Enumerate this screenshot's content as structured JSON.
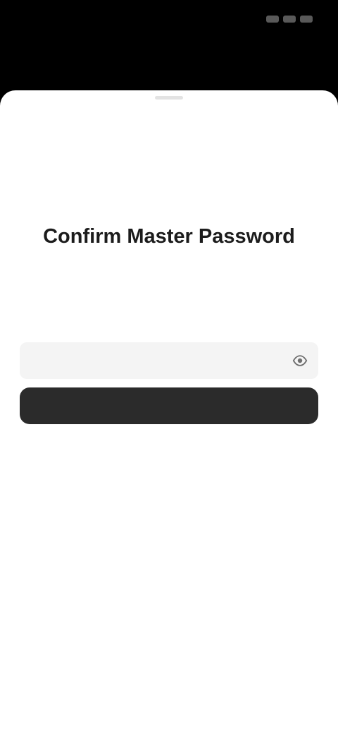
{
  "status_bar": {
    "time": "",
    "icons": [
      "signal-icon",
      "wifi-icon",
      "battery-icon"
    ]
  },
  "screen": {
    "title": "Confirm Master Password",
    "subtitle": "",
    "links": {
      "left": "",
      "right": ""
    },
    "password_field": {
      "value": "",
      "placeholder": ""
    },
    "primary_button": {
      "label": ""
    }
  },
  "colors": {
    "background": "#ffffff",
    "field": "#f4f4f4",
    "button": "#2b2b2b",
    "status_bar": "#000000"
  }
}
